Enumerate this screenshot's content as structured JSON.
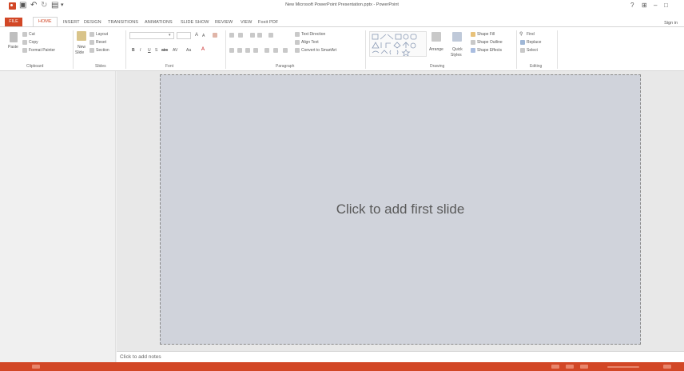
{
  "window": {
    "title": "New Microsoft PowerPoint Presentation.pptx - PowerPoint",
    "controls": [
      "?",
      "⊞",
      "–",
      "□"
    ]
  },
  "qat": {
    "save_icon": "save-icon",
    "undo_icon": "undo-icon",
    "redo_icon": "redo-icon",
    "present_icon": "present-icon",
    "customize": "▾"
  },
  "tabs": {
    "file": "FILE",
    "home": "HOME",
    "items": [
      "INSERT",
      "DESIGN",
      "TRANSITIONS",
      "ANIMATIONS",
      "SLIDE SHOW",
      "REVIEW",
      "VIEW",
      "Foxit PDF"
    ],
    "signin": "Sign in"
  },
  "ribbon": {
    "clipboard": {
      "label": "Clipboard",
      "paste": "Paste",
      "cut": "Cut",
      "copy": "Copy",
      "format_painter": "Format Painter"
    },
    "slides": {
      "label": "Slides",
      "new_slide": "New",
      "new_slide_2": "Slide",
      "layout": "Layout",
      "reset": "Reset",
      "section": "Section"
    },
    "font": {
      "label": "Font",
      "bold": "B",
      "italic": "I",
      "underline": "U",
      "shadow": "S",
      "strike": "abc",
      "spacing": "AV",
      "case": "Aa",
      "color": "A",
      "grow": "A",
      "shrink": "A"
    },
    "paragraph": {
      "label": "Paragraph",
      "text_direction": "Text Direction",
      "align_text": "Align Text",
      "smartart": "Convert to SmartArt"
    },
    "drawing": {
      "label": "Drawing",
      "arrange": "Arrange",
      "quick_styles": "Quick",
      "quick_styles_2": "Styles",
      "shape_fill": "Shape Fill",
      "shape_outline": "Shape Outline",
      "shape_effects": "Shape Effects"
    },
    "editing": {
      "label": "Editing",
      "find": "Find",
      "replace": "Replace",
      "select": "Select"
    }
  },
  "slide": {
    "placeholder": "Click to add first slide"
  },
  "notes": {
    "placeholder": "Click to add notes"
  },
  "colors": {
    "accent": "#d24726",
    "slide_bg": "#d0d3db"
  }
}
